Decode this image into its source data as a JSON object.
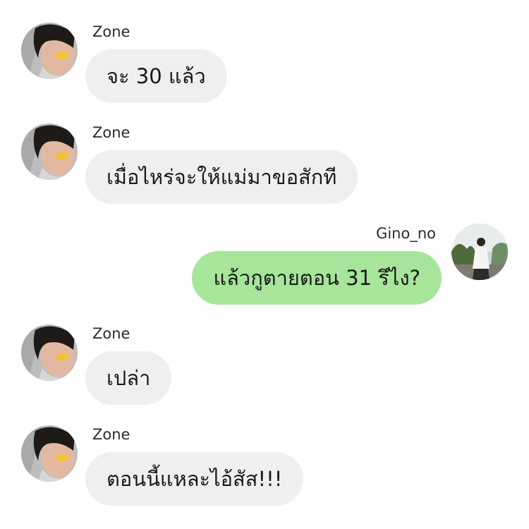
{
  "messages": [
    {
      "sender": "Zone",
      "text": "จะ 30 แล้ว",
      "direction": "incoming",
      "avatar": "zone-avatar"
    },
    {
      "sender": "Zone",
      "text": "เมื่อไหร่จะให้แม่มาขอสักที",
      "direction": "incoming",
      "avatar": "zone-avatar"
    },
    {
      "sender": "Gino_no",
      "text": "แล้วกูตายตอน 31 รึไง?",
      "direction": "outgoing",
      "avatar": "gino-avatar"
    },
    {
      "sender": "Zone",
      "text": "เปล่า",
      "direction": "incoming",
      "avatar": "zone-avatar"
    },
    {
      "sender": "Zone",
      "text": "ตอนนี้แหละไอ้สัส!!!",
      "direction": "incoming",
      "avatar": "zone-avatar"
    }
  ],
  "colors": {
    "incoming_bubble": "#efefef",
    "outgoing_bubble": "#a6e59a",
    "background": "#ffffff"
  }
}
